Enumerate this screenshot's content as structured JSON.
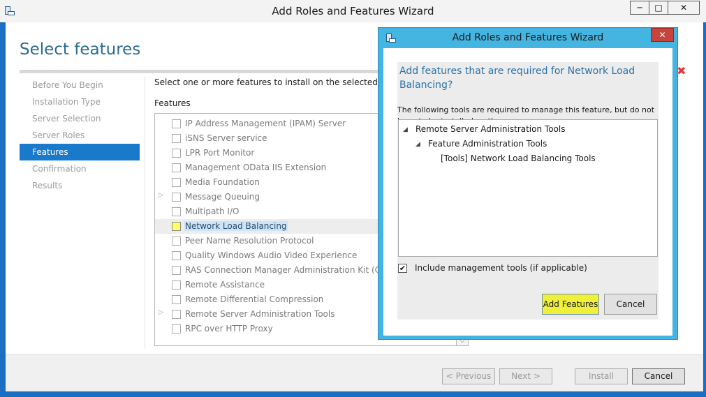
{
  "main_window": {
    "title": "Add Roles and Features Wizard",
    "controls": {
      "minimize": "─",
      "maximize": "□",
      "close": "✕"
    }
  },
  "page": {
    "title": "Select features",
    "instruction": "Select one or more features to install on the selected server.",
    "features_label": "Features"
  },
  "nav": [
    {
      "label": "Before You Begin",
      "active": false
    },
    {
      "label": "Installation Type",
      "active": false
    },
    {
      "label": "Server Selection",
      "active": false
    },
    {
      "label": "Server Roles",
      "active": false
    },
    {
      "label": "Features",
      "active": true
    },
    {
      "label": "Confirmation",
      "active": false
    },
    {
      "label": "Results",
      "active": false
    }
  ],
  "features": [
    {
      "label": "IP Address Management (IPAM) Server",
      "expandable": false,
      "selected": false
    },
    {
      "label": "iSNS Server service",
      "expandable": false,
      "selected": false
    },
    {
      "label": "LPR Port Monitor",
      "expandable": false,
      "selected": false
    },
    {
      "label": "Management OData IIS Extension",
      "expandable": false,
      "selected": false
    },
    {
      "label": "Media Foundation",
      "expandable": false,
      "selected": false
    },
    {
      "label": "Message Queuing",
      "expandable": true,
      "selected": false
    },
    {
      "label": "Multipath I/O",
      "expandable": false,
      "selected": false
    },
    {
      "label": "Network Load Balancing",
      "expandable": false,
      "selected": true
    },
    {
      "label": "Peer Name Resolution Protocol",
      "expandable": false,
      "selected": false
    },
    {
      "label": "Quality Windows Audio Video Experience",
      "expandable": false,
      "selected": false
    },
    {
      "label": "RAS Connection Manager Administration Kit (CMAK)",
      "expandable": false,
      "selected": false
    },
    {
      "label": "Remote Assistance",
      "expandable": false,
      "selected": false
    },
    {
      "label": "Remote Differential Compression",
      "expandable": false,
      "selected": false
    },
    {
      "label": "Remote Server Administration Tools",
      "expandable": true,
      "selected": false
    },
    {
      "label": "RPC over HTTP Proxy",
      "expandable": false,
      "selected": false
    }
  ],
  "bottom_buttons": {
    "previous": "< Previous",
    "next": "Next >",
    "install": "Install",
    "cancel": "Cancel"
  },
  "dialog": {
    "title": "Add Roles and Features Wizard",
    "close": "✕",
    "heading": "Add features that are required for Network Load Balancing?",
    "description": "The following tools are required to manage this feature, but do not have to be installed on the same server.",
    "tree": [
      {
        "label": "Remote Server Administration Tools",
        "level": 0,
        "expanded": true
      },
      {
        "label": "Feature Administration Tools",
        "level": 1,
        "expanded": true
      },
      {
        "label": "[Tools] Network Load Balancing Tools",
        "level": 2,
        "expanded": false
      }
    ],
    "include_label": "Include management tools (if applicable)",
    "include_checked": true,
    "check_mark": "✔",
    "add_button": "Add Features",
    "cancel_button": "Cancel"
  },
  "colors": {
    "accent": "#1979ca",
    "dialog_frame": "#44b4e0",
    "highlight": "#f0f03a",
    "close_red": "#c7433b",
    "error_x": "#e23a3a"
  }
}
